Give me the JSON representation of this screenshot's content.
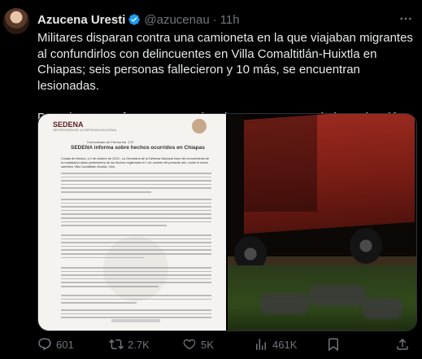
{
  "tweet": {
    "author_name": "Azucena Uresti",
    "handle": "@azucenau",
    "separator": "·",
    "time": "11h",
    "paragraphs": [
      "Militares disparan contra una camioneta en la que viajaban migrantes al confundirlos con delincuentes en Villa Comaltitlán-Huixtla en Chiapas; seis personas fallecieron y 10 más, se encuentran lesionadas.",
      "Dos elementos fueron separados de sus cargos por la investigación"
    ]
  },
  "document": {
    "logo": "SEDENA",
    "logo_sub": "SECRETARÍA DE LA DEFENSA NACIONAL",
    "number": "Comunicado de Prensa No. 173",
    "title": "SEDENA informa sobre hechos ocurridos en Chiapas",
    "date_line": "Ciudad de México, a 2 de octubre de 2024.- La Secretaría de la Defensa Nacional hace del conocimiento de la ciudadanía datos preliminares de los hechos registrados el 1 de octubre del presente año, sobre el tramo carretero Villa Comaltitlán-Huixtla, Chis."
  },
  "actions": {
    "reply_count": "601",
    "retweet_count": "2.7K",
    "like_count": "5K",
    "views_count": "461K"
  },
  "icons": {
    "verified": "verified-badge-icon",
    "more": "more-icon",
    "reply": "reply-icon",
    "retweet": "retweet-icon",
    "like": "heart-icon",
    "views": "views-icon",
    "bookmark": "bookmark-icon",
    "share": "share-icon"
  },
  "colors": {
    "background": "#000000",
    "text": "#e7e9ea",
    "muted": "#71767b",
    "verified": "#1d9bf0"
  }
}
